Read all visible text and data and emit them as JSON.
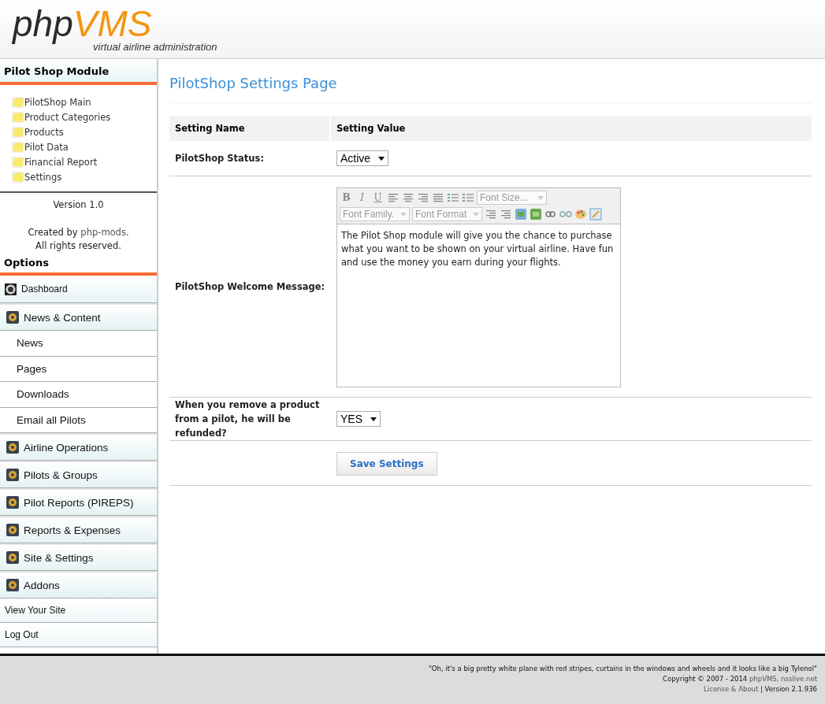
{
  "header": {
    "logo_prefix": "php",
    "logo_suffix": "VMS",
    "tagline": "virtual airline administration"
  },
  "module_panel": {
    "title": "Pilot Shop Module",
    "items": [
      "PilotShop Main",
      "Product Categories",
      "Products",
      "Pilot Data",
      "Financial Report",
      "Settings"
    ],
    "version": "Version 1.0",
    "credit_prefix": "Created by ",
    "credit_link": "php-mods",
    "credit_suffix": ".",
    "rights": "All rights reserved."
  },
  "options": {
    "title": "Options",
    "items": [
      {
        "label": "Dashboard",
        "kind": "top"
      },
      {
        "label": "News & Content",
        "kind": "section"
      },
      {
        "label": "News",
        "kind": "sub"
      },
      {
        "label": "Pages",
        "kind": "sub"
      },
      {
        "label": "Downloads",
        "kind": "sub"
      },
      {
        "label": "Email all Pilots",
        "kind": "sub"
      },
      {
        "label": "Airline Operations",
        "kind": "section"
      },
      {
        "label": "Pilots & Groups",
        "kind": "section"
      },
      {
        "label": "Pilot Reports (PIREPS)",
        "kind": "section"
      },
      {
        "label": "Reports & Expenses",
        "kind": "section"
      },
      {
        "label": "Site & Settings",
        "kind": "section"
      },
      {
        "label": "Addons",
        "kind": "section"
      },
      {
        "label": "View Your Site",
        "kind": "plain"
      },
      {
        "label": "Log Out",
        "kind": "plain"
      }
    ]
  },
  "main": {
    "title": "PilotShop Settings Page",
    "columns": [
      "Setting Name",
      "Setting Value"
    ],
    "rows": [
      {
        "label": "PilotShop Status:",
        "kind": "select",
        "value": "Active"
      },
      {
        "label": "PilotShop Welcome Message:",
        "kind": "editor",
        "format_buttons": [
          "B",
          "I",
          "U"
        ],
        "font_size": "Font Size...",
        "font_family": "Font Family.",
        "font_format": "Font Format",
        "value": "The Pilot Shop module will give you the chance to purchase what you want to be shown on your virtual airline. Have fun and use the money you earn during your flights."
      },
      {
        "label": "When you remove a product from a pilot, he will be refunded?",
        "kind": "select",
        "value": "YES"
      },
      {
        "kind": "button",
        "value": "Save Settings"
      }
    ]
  },
  "footer": {
    "quote": "\"Oh, it's a big pretty white plane with red stripes, curtains in the windows and wheels and it looks like a big Tylenol\"",
    "copyright": "Copyright © 2007 - 2014 ",
    "brand_link": "phpVMS",
    "site_link": ", nsslive.net",
    "license_link": "License & About",
    "version": "| Version 2.1.936"
  }
}
